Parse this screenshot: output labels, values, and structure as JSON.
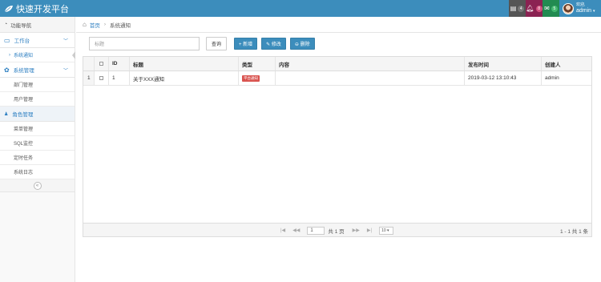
{
  "app": {
    "title": "快速开发平台"
  },
  "header": {
    "icons": [
      {
        "icon": "message-icon",
        "count": "4",
        "color": "#555555"
      },
      {
        "icon": "bell-icon",
        "count": "8",
        "color": "#8b2252"
      },
      {
        "icon": "mail-icon",
        "count": "5",
        "color": "#228b51"
      }
    ],
    "user": {
      "welcome": "欢迎,",
      "name": "admin"
    }
  },
  "sidebar": {
    "header": "功能导航",
    "groups": [
      {
        "label": "工作台",
        "icon": "monitor-icon",
        "items": [
          "系统通知"
        ]
      },
      {
        "label": "系统管理",
        "icon": "gear-icon",
        "items": [
          "部门管理",
          "用户管理"
        ]
      },
      {
        "label": "角色管理",
        "icon": "user-icon",
        "items": [
          "菜单管理",
          "SQL监控",
          "定时任务",
          "系统日志"
        ]
      }
    ],
    "collapse": "«"
  },
  "breadcrumb": {
    "home": "首页",
    "current": "系统通知"
  },
  "toolbar": {
    "search_placeholder": "标题",
    "query": "查询",
    "add": "+ 新增",
    "edit": "✎ 修改",
    "delete": "⊖ 删除"
  },
  "table": {
    "headers": {
      "id": "ID",
      "title": "标题",
      "type": "类型",
      "content": "内容",
      "time": "发布时间",
      "creator": "创建人"
    },
    "rows": [
      {
        "num": "1",
        "id": "1",
        "title": "关于XXX通知",
        "type": "平台通知",
        "content": "",
        "time": "2019-03-12 13:10:43",
        "creator": "admin"
      }
    ]
  },
  "pager": {
    "page": "1",
    "of": "共 1 页",
    "size": "10 ▾",
    "info": "1 - 1  共 1 条"
  },
  "colors": {
    "primary": "#3c8dbc",
    "tag": "#d9534f"
  }
}
